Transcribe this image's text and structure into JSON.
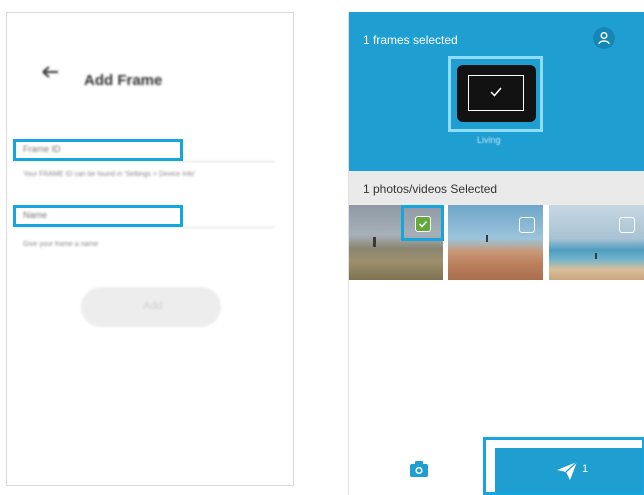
{
  "left_screen": {
    "title": "Add Frame",
    "frame_id_field": {
      "placeholder": "Frame ID",
      "hint": "Your FRAME ID can be found in 'Settings > Device Info'"
    },
    "name_field": {
      "placeholder": "Name",
      "hint": "Give your frame a name"
    },
    "add_button_label": "Add"
  },
  "right_screen": {
    "frames_selected": "1 frames selected",
    "frame_name": "Living",
    "photos_selected": "1 photos/videos Selected",
    "photos": [
      {
        "name": "beach-with-person",
        "selected": true
      },
      {
        "name": "sunset-dune",
        "selected": false
      },
      {
        "name": "sea-horizon",
        "selected": false
      }
    ],
    "send_count": "1"
  },
  "colors": {
    "accent": "#1f9fd1",
    "highlight": "#16a6dd",
    "check_green": "#64a93b"
  },
  "icons": [
    "back-arrow-icon",
    "user-icon",
    "frame-device-icon",
    "checkmark-icon",
    "camera-icon",
    "send-icon"
  ]
}
